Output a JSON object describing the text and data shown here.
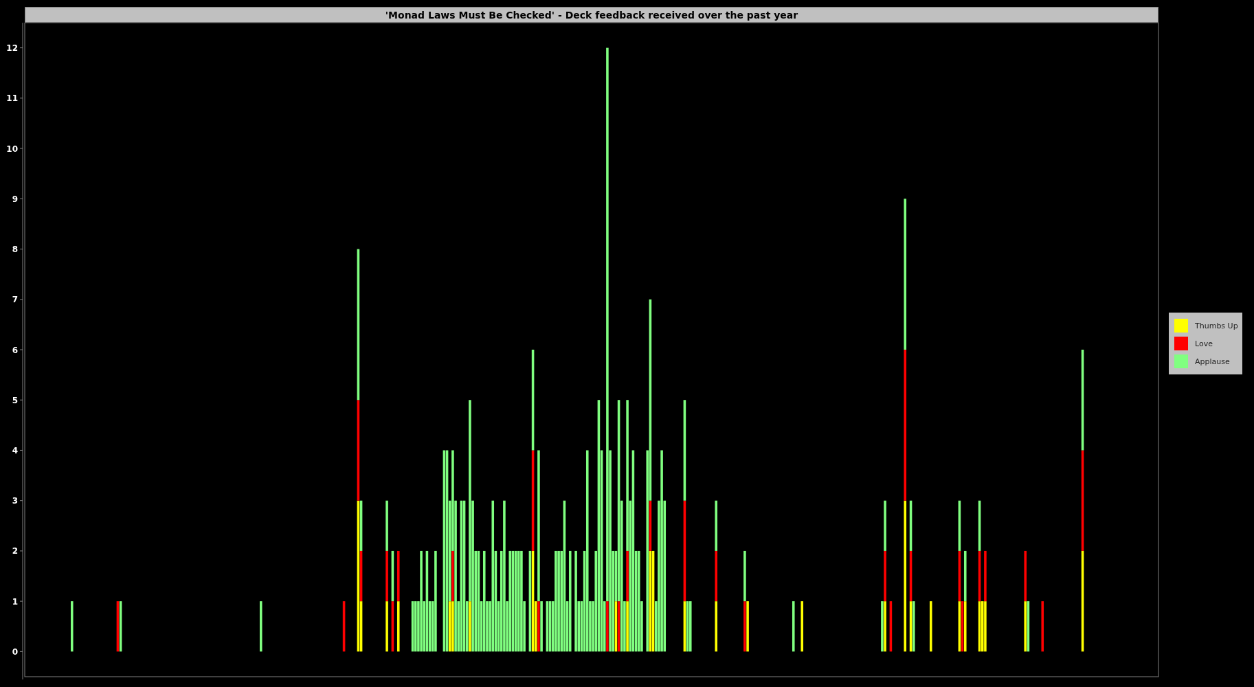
{
  "chart": {
    "title": "'Monad Laws Must Be Checked' - Deck feedback received over the past year",
    "y_axis_labels": [
      "12",
      "11",
      "10",
      "9",
      "8",
      "7",
      "6",
      "5",
      "4",
      "3",
      "2",
      "1",
      "0"
    ],
    "legend": [
      {
        "label": "Thumbs Up",
        "color": "#ffff00"
      },
      {
        "label": "Love",
        "color": "#ff0000"
      },
      {
        "label": "Applause",
        "color": "#80ff80"
      }
    ]
  }
}
